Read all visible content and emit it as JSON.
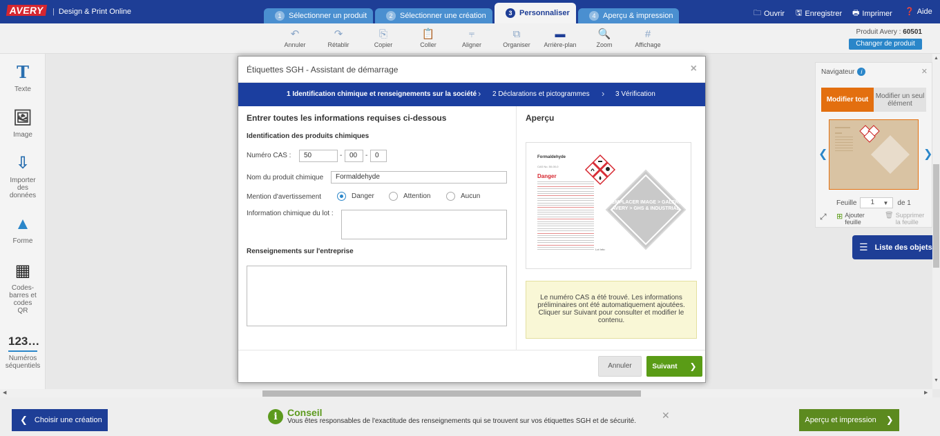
{
  "header": {
    "brand": "AVERY",
    "subtitle": "Design & Print Online",
    "steps": [
      {
        "num": "1",
        "label": "Sélectionner un produit"
      },
      {
        "num": "2",
        "label": "Sélectionner une création"
      },
      {
        "num": "3",
        "label": "Personnaliser"
      },
      {
        "num": "4",
        "label": "Aperçu & impression"
      }
    ],
    "actions": [
      {
        "icon": "folder-icon",
        "glyph": "🗀",
        "label": "Ouvrir"
      },
      {
        "icon": "save-icon",
        "glyph": "🖫",
        "label": "Enregistrer"
      },
      {
        "icon": "print-icon",
        "glyph": "🖶",
        "label": "Imprimer"
      },
      {
        "icon": "help-icon",
        "glyph": "❓",
        "label": "Aide"
      }
    ]
  },
  "toolbar": {
    "items": [
      {
        "label": "Annuler",
        "glyph": "↶"
      },
      {
        "label": "Rétablir",
        "glyph": "↷"
      },
      {
        "label": "Copier",
        "glyph": "⎘"
      },
      {
        "label": "Coller",
        "glyph": "📋"
      },
      {
        "label": "Aligner",
        "glyph": "⫧"
      },
      {
        "label": "Organiser",
        "glyph": "⧉"
      },
      {
        "label": "Arrière-plan",
        "glyph": "▬"
      },
      {
        "label": "Zoom",
        "glyph": "🔍"
      },
      {
        "label": "Affichage",
        "glyph": "#"
      }
    ],
    "product_label": "Produit Avery :",
    "product_number": "60501",
    "change_product": "Changer de produit"
  },
  "left_tools": [
    {
      "label": "Texte",
      "glyph": "T"
    },
    {
      "label": "Image",
      "glyph": "🖼"
    },
    {
      "label": "Importer des données",
      "glyph": "⇩"
    },
    {
      "label": "Forme",
      "glyph": "▲"
    },
    {
      "label": "Codes-barres et codes QR",
      "glyph": "▦"
    },
    {
      "label": "Numéros séquentiels",
      "glyph": "123…"
    }
  ],
  "navigator": {
    "title": "Navigateur",
    "tab_all": "Modifier tout",
    "tab_single": "Modifier un seul élément",
    "sheet_label": "Feuille",
    "sheet_value": "1",
    "sheet_of": "de 1",
    "add_sheet": "Ajouter feuille",
    "delete_sheet": "Supprimer la feuille",
    "objects_list": "Liste des objets"
  },
  "modal": {
    "title": "Étiquettes SGH - Assistant de démarrage",
    "wizard_steps": [
      "1 Identification chimique et renseignements sur la société",
      "2 Déclarations et pictogrammes",
      "3 Vérification"
    ],
    "form_heading": "Entrer toutes les informations requises ci-dessous",
    "section_chem": "Identification des produits chimiques",
    "cas_label": "Numéro CAS :",
    "cas_1": "50",
    "cas_2": "00",
    "cas_3": "0",
    "product_name_label": "Nom du produit chimique",
    "product_name_value": "Formaldehyde",
    "warning_label": "Mention d'avertissement",
    "radio_danger": "Danger",
    "radio_attention": "Attention",
    "radio_none": "Aucun",
    "lot_label": "Information chimique du lot :",
    "section_company": "Renseignements sur l'entreprise",
    "preview_title": "Aperçu",
    "preview": {
      "name": "Formaldehyde",
      "cas": "CAS No. 50-00-0",
      "danger": "Danger",
      "replace_text": "REMPLACER IMAGE > GALERIE AVERY > GHS & INDUSTRIAL",
      "lot": "Lot Info:"
    },
    "notice": "Le numéro CAS a été trouvé. Les informations préliminaires ont été automatiquement ajoutées. Cliquer sur Suivant pour consulter et modifier le contenu.",
    "cancel": "Annuler",
    "next": "Suivant"
  },
  "footer": {
    "choose_design": "Choisir une création",
    "tip_title": "Conseil",
    "tip_text": "Vous êtes responsables de l'exactitude des renseignements qui se trouvent sur vos étiquettes SGH et de sécurité.",
    "preview_print": "Aperçu et impression"
  },
  "colors": {
    "brand_blue": "#1e3e96",
    "accent_orange": "#e36f0f",
    "accent_green": "#5a9c16",
    "danger_red": "#d6262f"
  }
}
